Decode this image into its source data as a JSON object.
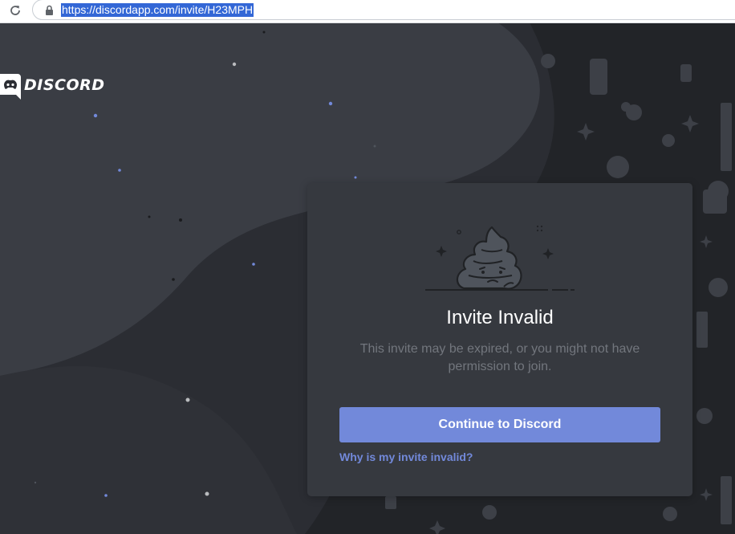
{
  "browser": {
    "url": "https://discordapp.com/invite/H23MPH"
  },
  "logo": {
    "wordmark": "DISCORD"
  },
  "invite_card": {
    "title": "Invite Invalid",
    "subtitle": "This invite may be expired, or you might not have permission to join.",
    "continue_button_label": "Continue to Discord",
    "help_link_text": "Why is my invite invalid?"
  },
  "colors": {
    "accent": "#7289da",
    "card_background": "#36393f",
    "page_background": "#2b2d33",
    "muted_text": "#72767d"
  },
  "icons": [
    "reload-icon",
    "lock-icon",
    "discord-logo-icon",
    "poop-illustration"
  ]
}
